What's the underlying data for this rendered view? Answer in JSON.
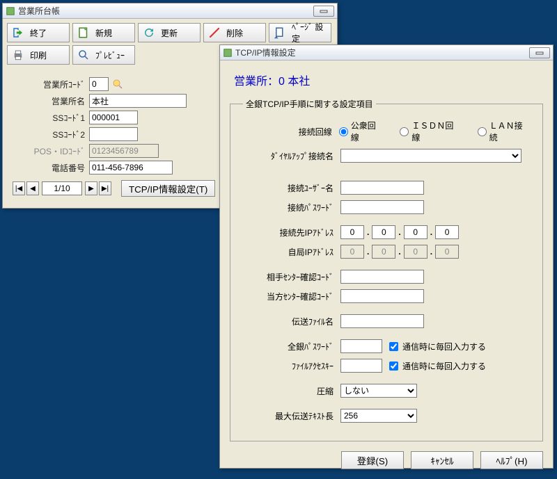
{
  "mainWindow": {
    "title": "営業所台帳",
    "toolbar": {
      "exit": "終了",
      "new": "新規",
      "update": "更新",
      "delete": "削除",
      "pageSetup": "ﾍﾟｰｼﾞ 設定",
      "print": "印刷",
      "preview": "ﾌﾟﾚﾋﾞｭｰ"
    },
    "fields": {
      "branchCodeLabel": "営業所ｺｰﾄﾞ",
      "branchCodeValue": "0",
      "branchNameLabel": "営業所名",
      "branchNameValue": "本社",
      "ssCode1Label": "SSｺｰﾄﾞ1",
      "ssCode1Value": "000001",
      "ssCode2Label": "SSｺｰﾄﾞ2",
      "ssCode2Value": "",
      "posIdLabel": "POS・IDｺｰﾄﾞ",
      "posIdValue": "0123456789",
      "phoneLabel": "電話番号",
      "phoneValue": "011-456-7896"
    },
    "nav": {
      "page": "1/10",
      "tcpBtn": "TCP/IP情報設定(T)"
    }
  },
  "dialog": {
    "title": "TCP/IP情報設定",
    "headerLabel": "営業所：0  本社",
    "groupTitle": "全銀TCP/IP手順に関する設定項目",
    "lineLabel": "接続回線",
    "lineOptions": {
      "public": "公衆回線",
      "isdn": "ＩＳＤＮ回線",
      "lan": "ＬＡＮ接続"
    },
    "dialupLabel": "ﾀﾞｲﾔﾙｱｯﾌﾟ接続名",
    "dialupValue": "",
    "userLabel": "接続ﾕｰｻﾞｰ名",
    "userValue": "",
    "passLabel": "接続ﾊﾟｽﾜｰﾄﾞ",
    "passValue": "",
    "remoteIpLabel": "接続先IPｱﾄﾞﾚｽ",
    "remoteIp": [
      "0",
      "0",
      "0",
      "0"
    ],
    "localIpLabel": "自局IPｱﾄﾞﾚｽ",
    "localIp": [
      "0",
      "0",
      "0",
      "0"
    ],
    "remoteCenterLabel": "相手ｾﾝﾀｰ確認ｺｰﾄﾞ",
    "remoteCenterValue": "",
    "localCenterLabel": "当方ｾﾝﾀｰ確認ｺｰﾄﾞ",
    "localCenterValue": "",
    "fileNameLabel": "伝送ﾌｧｲﾙ名",
    "fileNameValue": "",
    "zPassLabel": "全銀ﾊﾟｽﾜｰﾄﾞ",
    "zPassValue": "",
    "promptText": "通信時に毎回入力する",
    "fileKeyLabel": "ﾌｧｲﾙｱｸｾｽｷｰ",
    "fileKeyValue": "",
    "compressLabel": "圧縮",
    "compressValue": "しない",
    "maxLenLabel": "最大伝送ﾃｷｽﾄ長",
    "maxLenValue": "256",
    "buttons": {
      "register": "登録(S)",
      "cancel": "ｷｬﾝｾﾙ",
      "help": "ﾍﾙﾌﾟ(H)"
    }
  }
}
